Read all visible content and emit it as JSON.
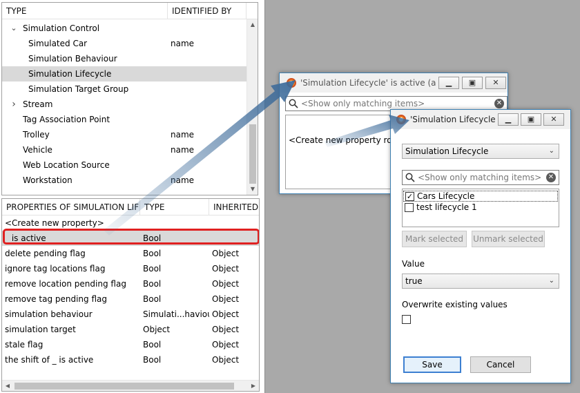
{
  "type_tree": {
    "headers": {
      "type": "TYPE",
      "identified_by": "IDENTIFIED BY"
    },
    "rows": [
      {
        "label": "Simulation Control",
        "ident": "",
        "indent": 1,
        "toggle": "expanded",
        "selected": false
      },
      {
        "label": "Simulated Car",
        "ident": "name",
        "indent": 2,
        "toggle": "",
        "selected": false
      },
      {
        "label": "Simulation Behaviour",
        "ident": "",
        "indent": 2,
        "toggle": "",
        "selected": false
      },
      {
        "label": "Simulation Lifecycle",
        "ident": "",
        "indent": 2,
        "toggle": "",
        "selected": true
      },
      {
        "label": "Simulation Target Group",
        "ident": "",
        "indent": 2,
        "toggle": "",
        "selected": false
      },
      {
        "label": "Stream",
        "ident": "",
        "indent": 1,
        "toggle": "collapsed",
        "selected": false
      },
      {
        "label": "Tag Association Point",
        "ident": "",
        "indent": 1,
        "toggle": "",
        "selected": false
      },
      {
        "label": "Trolley",
        "ident": "name",
        "indent": 1,
        "toggle": "",
        "selected": false
      },
      {
        "label": "Vehicle",
        "ident": "name",
        "indent": 1,
        "toggle": "",
        "selected": false
      },
      {
        "label": "Web Location Source",
        "ident": "",
        "indent": 1,
        "toggle": "",
        "selected": false
      },
      {
        "label": "Workstation",
        "ident": "name",
        "indent": 1,
        "toggle": "",
        "selected": false
      }
    ]
  },
  "properties_table": {
    "headers": {
      "name": "PROPERTIES OF SIMULATION LIFE...",
      "type": "TYPE",
      "inherited": "INHERITED F"
    },
    "create_row": "<Create new property>",
    "rows": [
      {
        "name": "_ is active",
        "type": "Bool",
        "inherited": "",
        "selected": true
      },
      {
        "name": "delete pending flag",
        "type": "Bool",
        "inherited": "Object",
        "selected": false
      },
      {
        "name": "ignore tag locations flag",
        "type": "Bool",
        "inherited": "Object",
        "selected": false
      },
      {
        "name": "remove location pending flag",
        "type": "Bool",
        "inherited": "Object",
        "selected": false
      },
      {
        "name": "remove tag pending flag",
        "type": "Bool",
        "inherited": "Object",
        "selected": false
      },
      {
        "name": "simulation behaviour",
        "type": "Simulati...haviour",
        "inherited": "Object",
        "selected": false
      },
      {
        "name": "simulation target",
        "type": "Object",
        "inherited": "Object",
        "selected": false
      },
      {
        "name": "stale flag",
        "type": "Bool",
        "inherited": "Object",
        "selected": false
      },
      {
        "name": "the shift of _ is active",
        "type": "Bool",
        "inherited": "Object",
        "selected": false
      }
    ]
  },
  "dialog_back": {
    "title": "'Simulation Lifecycle' is active (asse...",
    "search_placeholder": "<Show only matching items>",
    "create_row": "<Create new property row>"
  },
  "dialog_front": {
    "title": "'Simulation Lifecycle'...",
    "type_select": "Simulation Lifecycle",
    "search_placeholder": "<Show only matching items>",
    "items": [
      {
        "label": "Cars Lifecycle",
        "checked": true
      },
      {
        "label": "test lifecycle 1",
        "checked": false
      }
    ],
    "mark_selected": "Mark selected",
    "unmark_selected": "Unmark selected",
    "value_label": "Value",
    "value_select": "true",
    "overwrite_label": "Overwrite existing values",
    "overwrite_checked": false,
    "save": "Save",
    "cancel": "Cancel"
  },
  "icons": {
    "expanded": "chevron-down-icon",
    "collapsed": "chevron-right-icon",
    "search": "search-icon",
    "clear": "clear-icon",
    "minimize": "minimize-icon",
    "maximize": "maximize-icon",
    "close": "close-icon"
  },
  "colors": {
    "highlight": "#e02020",
    "arrow": "#3d6b9a",
    "selection": "#d9d9d9",
    "desktop": "#a9a9a9"
  }
}
